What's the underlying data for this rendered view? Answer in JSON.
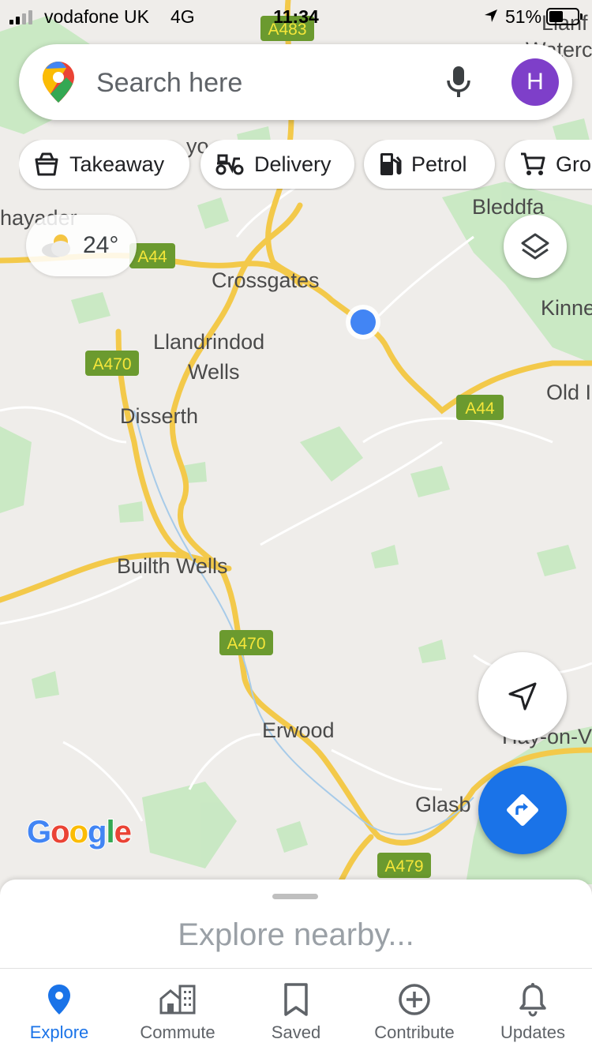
{
  "status_bar": {
    "carrier": "vodafone UK",
    "network": "4G",
    "time": "11:34",
    "battery": "51%",
    "battery_level": 0.51
  },
  "search": {
    "placeholder": "Search here",
    "avatar_initial": "H"
  },
  "chips": [
    {
      "label": "Takeaway",
      "icon": "takeaway-icon"
    },
    {
      "label": "Delivery",
      "icon": "delivery-scooter-icon"
    },
    {
      "label": "Petrol",
      "icon": "petrol-pump-icon"
    },
    {
      "label": "Gro",
      "icon": "cart-icon"
    }
  ],
  "weather": {
    "temp": "24°",
    "icon": "partly-cloudy-icon"
  },
  "map": {
    "places": [
      "Crossgates",
      "Llandrindod",
      "Wells",
      "Disserth",
      "Builth Wells",
      "Erwood",
      "Bleddfa",
      "Kinne",
      "Old I",
      "Glasb",
      "Hay-on-V",
      "hayader",
      "Llanf",
      "Waterc",
      "yo"
    ],
    "roads": [
      "A483",
      "A44",
      "A470",
      "A44",
      "A470",
      "A479"
    ]
  },
  "google_logo": {
    "letters": [
      "G",
      "o",
      "o",
      "g",
      "l",
      "e"
    ],
    "colors": [
      "#4285F4",
      "#EA4335",
      "#FBBC05",
      "#4285F4",
      "#34A853",
      "#EA4335"
    ]
  },
  "sheet": {
    "title": "Explore nearby..."
  },
  "nav": [
    {
      "label": "Explore",
      "icon": "explore-pin-icon",
      "active": true
    },
    {
      "label": "Commute",
      "icon": "commute-building-icon",
      "active": false
    },
    {
      "label": "Saved",
      "icon": "bookmark-icon",
      "active": false
    },
    {
      "label": "Contribute",
      "icon": "plus-circle-icon",
      "active": false
    },
    {
      "label": "Updates",
      "icon": "bell-icon",
      "active": false
    }
  ],
  "colors": {
    "accent": "#1a73e8",
    "avatar": "#7e3fc9",
    "road_label_bg": "#6b9a2f",
    "road_label_text": "#f5e63a",
    "road": "#f6d44c"
  }
}
